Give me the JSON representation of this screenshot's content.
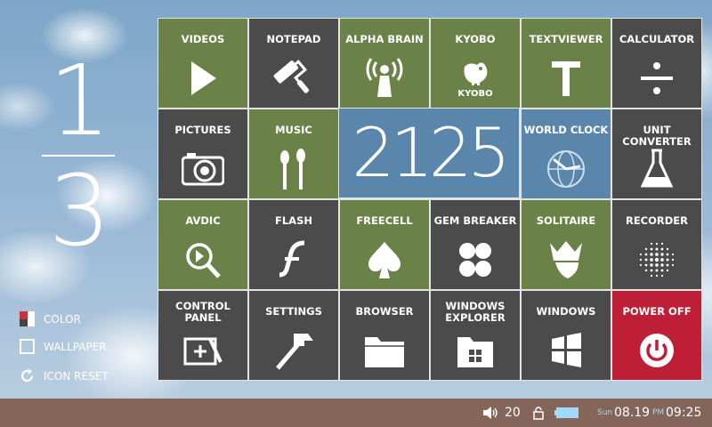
{
  "page": {
    "current": "1",
    "total": "3"
  },
  "side_menu": {
    "color": "COLOR",
    "wallpaper": "WALLPAPER",
    "icon_reset": "ICON RESET"
  },
  "tiles": [
    {
      "label": "VIDEOS",
      "icon": "play-icon",
      "color": "#6a8147"
    },
    {
      "label": "NOTEPAD",
      "icon": "paint-roller-icon",
      "color": "#4b4b4b"
    },
    {
      "label": "ALPHA BRAIN",
      "icon": "broadcast-icon",
      "color": "#6a8147"
    },
    {
      "label": "KYOBO",
      "icon": "kyobo-bird-icon",
      "sublabel": "KYOBO",
      "color": "#6a8147"
    },
    {
      "label": "TEXTVIEWER",
      "icon": "letter-t-icon",
      "color": "#6a8147"
    },
    {
      "label": "CALCULATOR",
      "icon": "divide-icon",
      "color": "#4b4b4b"
    },
    {
      "label": "PICTURES",
      "icon": "camera-icon",
      "color": "#4b4b4b"
    },
    {
      "label": "MUSIC",
      "icon": "earphones-icon",
      "color": "#6a8147"
    },
    {
      "label": "WORLD CLOCK",
      "icon": "globe-clock-icon",
      "color": "#5b86ac"
    },
    {
      "label": "UNIT CONVERTER",
      "icon": "flask-icon",
      "color": "#4b4b4b"
    },
    {
      "label": "AVDIC",
      "icon": "magnifier-icon",
      "color": "#6a8147"
    },
    {
      "label": "FLASH",
      "icon": "flash-icon",
      "color": "#4b4b4b"
    },
    {
      "label": "FREECELL",
      "icon": "spade-icon",
      "color": "#6a8147"
    },
    {
      "label": "GEM BREAKER",
      "icon": "gems-icon",
      "color": "#4b4b4b"
    },
    {
      "label": "SOLITAIRE",
      "icon": "king-icon",
      "color": "#6a8147"
    },
    {
      "label": "RECORDER",
      "icon": "dots-icon",
      "color": "#4b4b4b"
    },
    {
      "label": "CONTROL PANEL",
      "icon": "control-panel-icon",
      "color": "#4b4b4b"
    },
    {
      "label": "SETTINGS",
      "icon": "hammer-icon",
      "color": "#4b4b4b"
    },
    {
      "label": "BROWSER",
      "icon": "folder-icon",
      "color": "#4b4b4b"
    },
    {
      "label": "WINDOWS EXPLORER",
      "icon": "windows-folder-icon",
      "color": "#4b4b4b"
    },
    {
      "label": "WINDOWS",
      "icon": "windows-logo-icon",
      "color": "#4b4b4b"
    },
    {
      "label": "POWER OFF",
      "icon": "power-icon",
      "color": "#bf1e37"
    }
  ],
  "clock_widget": {
    "time": "2125"
  },
  "taskbar": {
    "volume": "20",
    "day": "Sun",
    "date": "08.19",
    "ampm": "PM",
    "time": "09:25",
    "bg_color": "#83655a"
  }
}
